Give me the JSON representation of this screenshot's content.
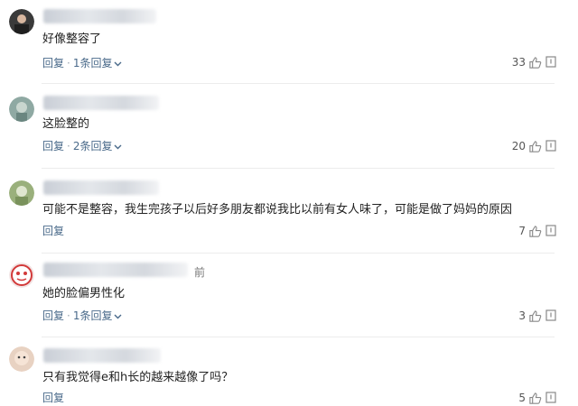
{
  "comments": [
    {
      "text": "好像整容了",
      "reply_label": "回复",
      "replies_label": "1条回复",
      "likes": "33",
      "avatar": "avatar-1"
    },
    {
      "text": "这脸整的",
      "reply_label": "回复",
      "replies_label": "2条回复",
      "likes": "20",
      "avatar": "avatar-2"
    },
    {
      "text": "可能不是整容，我生完孩子以后好多朋友都说我比以前有女人味了，可能是做了妈妈的原因",
      "reply_label": "回复",
      "replies_label": "",
      "likes": "7",
      "avatar": "avatar-3"
    },
    {
      "time_suffix": "前",
      "text": "她的脸偏男性化",
      "reply_label": "回复",
      "replies_label": "1条回复",
      "likes": "3",
      "avatar": "avatar-4"
    },
    {
      "text": "只有我觉得e和h长的越来越像了吗？",
      "reply_label": "回复",
      "replies_label": "",
      "likes": "5",
      "avatar": "avatar-5"
    }
  ],
  "icons": {
    "like": "thumbs-up-icon",
    "report": "report-icon",
    "expand": "chevron-down-icon"
  },
  "colors": {
    "link": "#4a6a8a",
    "text": "#222222",
    "meta": "#555555"
  }
}
